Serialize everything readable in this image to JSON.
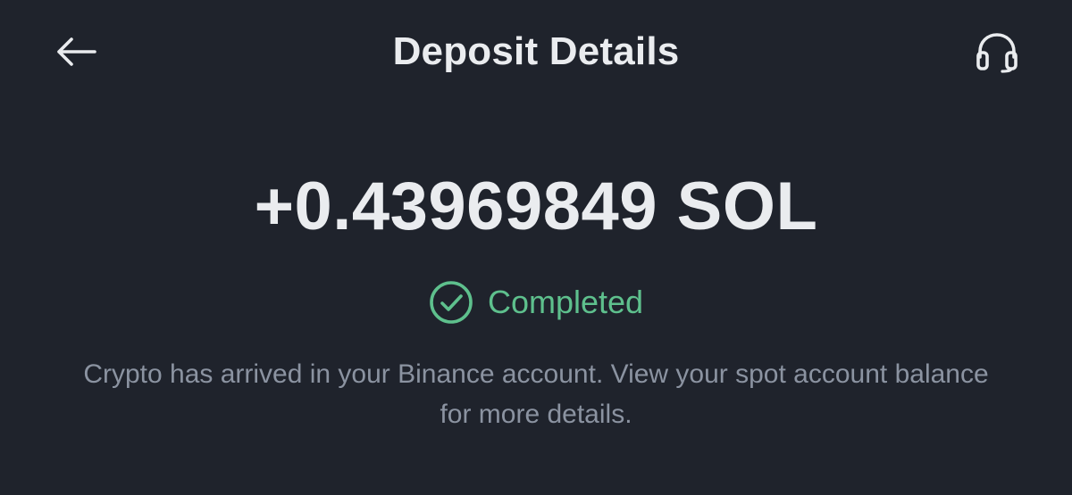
{
  "header": {
    "title": "Deposit Details",
    "back_icon": "arrow-left-icon",
    "support_icon": "headset-icon"
  },
  "deposit": {
    "amount": "+0.43969849 SOL",
    "status": "Completed",
    "status_icon": "check-circle-icon",
    "message": "Crypto has arrived in your Binance account. View your spot account balance for more details."
  },
  "colors": {
    "background": "#1f232c",
    "text": "#eaecef",
    "success": "#5ec08d",
    "muted": "#8b93a1"
  }
}
